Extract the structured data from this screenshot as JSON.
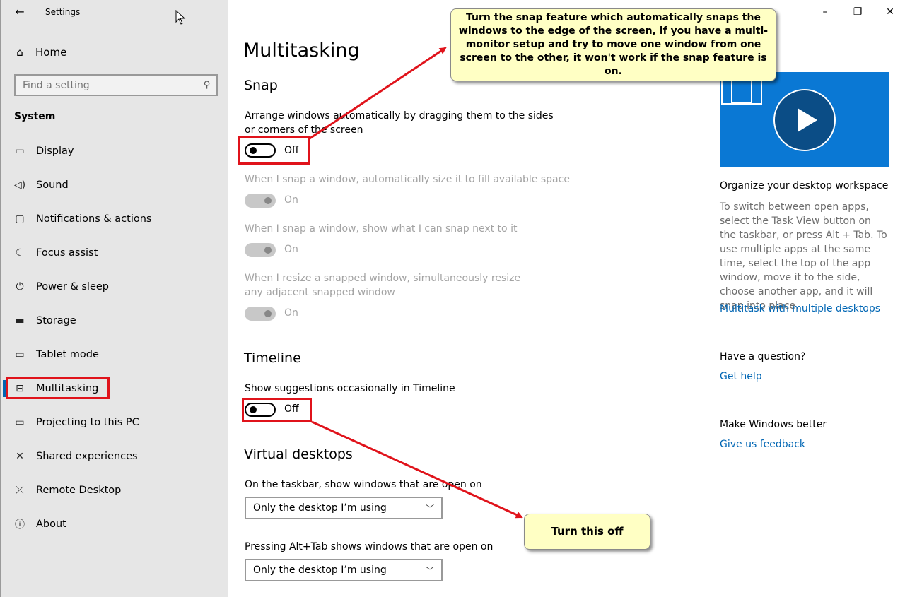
{
  "window": {
    "app_title": "Settings",
    "controls": {
      "minimize": "–",
      "maximize": "□",
      "close": "✕"
    }
  },
  "sidebar": {
    "home_label": "Home",
    "search_placeholder": "Find a setting",
    "section_label": "System",
    "items": [
      {
        "label": "Display",
        "icon": "display-icon",
        "glyph": "▭"
      },
      {
        "label": "Sound",
        "icon": "sound-icon",
        "glyph": "🕪"
      },
      {
        "label": "Notifications & actions",
        "icon": "notifications-icon",
        "glyph": "▢"
      },
      {
        "label": "Focus assist",
        "icon": "moon-icon",
        "glyph": "☾"
      },
      {
        "label": "Power & sleep",
        "icon": "power-icon",
        "glyph": "⏻"
      },
      {
        "label": "Storage",
        "icon": "storage-icon",
        "glyph": "▬"
      },
      {
        "label": "Tablet mode",
        "icon": "tablet-icon",
        "glyph": "▭"
      },
      {
        "label": "Multitasking",
        "icon": "multitasking-icon",
        "glyph": "⊟"
      },
      {
        "label": "Projecting to this PC",
        "icon": "projecting-icon",
        "glyph": "▭"
      },
      {
        "label": "Shared experiences",
        "icon": "shared-icon",
        "glyph": "✕"
      },
      {
        "label": "Remote Desktop",
        "icon": "remote-icon",
        "glyph": "✕"
      },
      {
        "label": "About",
        "icon": "info-icon",
        "glyph": "ⓘ"
      }
    ],
    "active_item": "Multitasking"
  },
  "main": {
    "title": "Multitasking",
    "snap": {
      "heading": "Snap",
      "arrange_desc": "Arrange windows automatically by dragging them to the sides or corners of the screen",
      "arrange_state": "Off",
      "fill_desc": "When I snap a window, automatically size it to fill available space",
      "fill_state": "On",
      "show_desc": "When I snap a window, show what I can snap next to it",
      "show_state": "On",
      "resize_desc": "When I resize a snapped window, simultaneously resize any adjacent snapped window",
      "resize_state": "On"
    },
    "timeline": {
      "heading": "Timeline",
      "desc": "Show suggestions occasionally in Timeline",
      "state": "Off"
    },
    "virtual_desktops": {
      "heading": "Virtual desktops",
      "taskbar_label": "On the taskbar, show windows that are open on",
      "taskbar_value": "Only the desktop I’m using",
      "alttab_label": "Pressing Alt+Tab shows windows that are open on",
      "alttab_value": "Only the desktop I’m using"
    }
  },
  "right": {
    "workspace_heading": "Organize your desktop workspace",
    "workspace_text": "To switch between open apps, select the Task View button on the taskbar, or press Alt + Tab. To use multiple apps at the same time, select the top of the app window, move it to the side, choose another app, and it will snap into place.",
    "workspace_link": "Multitask with multiple desktops",
    "question_heading": "Have a question?",
    "question_link": "Get help",
    "better_heading": "Make Windows better",
    "better_link": "Give us feedback"
  },
  "callouts": {
    "snap_note": "Turn the snap feature which automatically snaps the windows to the edge of the screen, if you have a multi-monitor setup and try to move one window from one screen to the other, it won't work if the snap feature is on.",
    "timeline_note": "Turn this off"
  },
  "colors": {
    "accent": "#0063b1",
    "link": "#0066b4",
    "annotation_red": "#e0131b",
    "callout_bg": "#ffffc4"
  }
}
